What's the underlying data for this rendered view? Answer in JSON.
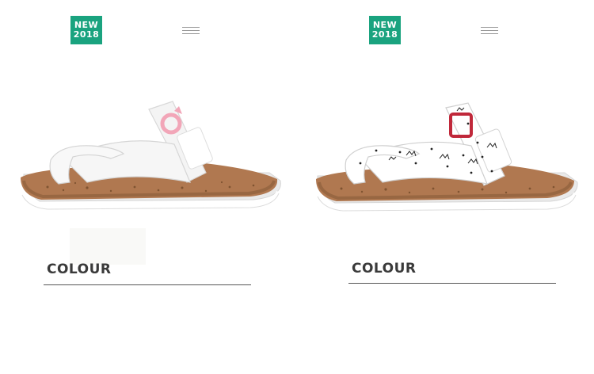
{
  "products": [
    {
      "badge": {
        "line1": "NEW",
        "line2": "2018"
      },
      "menu_icon": "hamburger-menu-icon",
      "section_label": "COLOUR",
      "variant": "white-pink-buckle",
      "colors": {
        "strap": "#f4f4f4",
        "cork": "#b07850",
        "buckle": "#f2a6b8"
      }
    },
    {
      "badge": {
        "line1": "NEW",
        "line2": "2018"
      },
      "menu_icon": "hamburger-menu-icon",
      "section_label": "COLOUR",
      "variant": "white-cat-print-red-buckle",
      "colors": {
        "strap": "#ffffff",
        "cork": "#b07850",
        "buckle": "#c0283a"
      }
    }
  ],
  "theme": {
    "badge_bg": "#1aa37f",
    "text": "#3a3a3a"
  }
}
